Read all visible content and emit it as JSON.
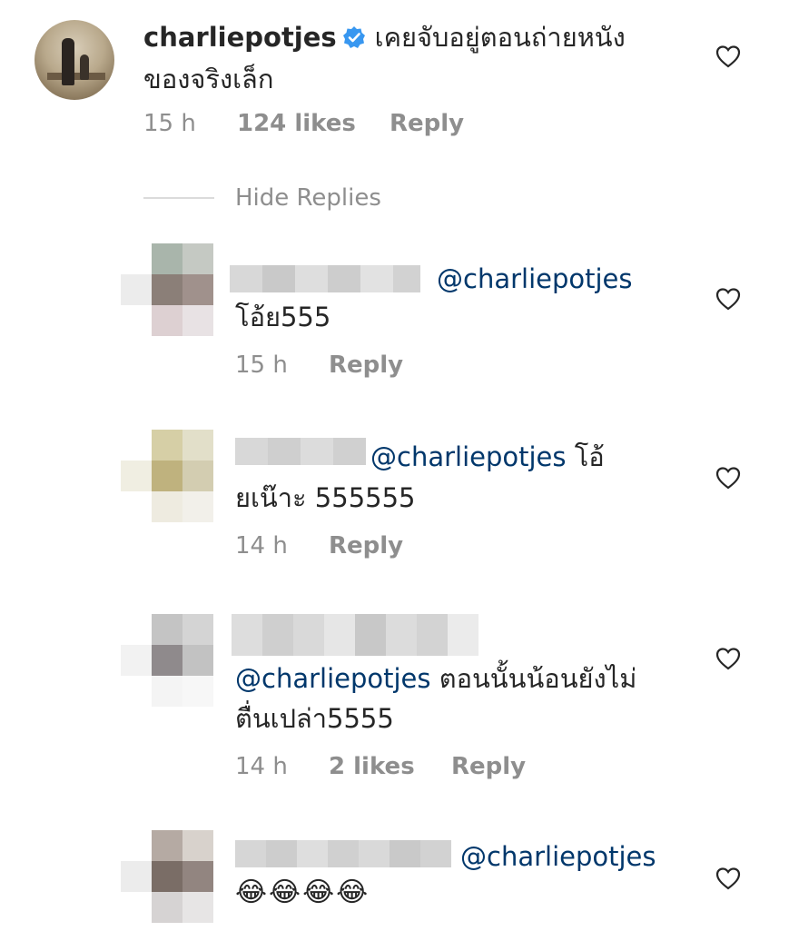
{
  "main_comment": {
    "author": "charlie­potjes",
    "text_line1": "เคยจับอยู่ตอนถ่ายหนัง",
    "text_line2": "ของจริงเล็ก",
    "time": "15 h",
    "likes": "124 likes",
    "reply": "Reply"
  },
  "hide_replies": "Hide Replies",
  "replies": [
    {
      "mention": "@charliepotjes",
      "text_line1": "โอ้ย555",
      "time": "15 h",
      "reply": "Reply"
    },
    {
      "mention": "@charliepotjes",
      "text_line1_after": " โอ้",
      "text_line2": "ยเน๊าะ 555555",
      "time": "14 h",
      "reply": "Reply"
    },
    {
      "mention": "@charliepotjes",
      "text_line1_after": " ตอนนั้นน้อนยังไม่",
      "text_line2": "ตื่นเปล่า5555",
      "time": "14 h",
      "likes": "2 likes",
      "reply": "Reply"
    },
    {
      "mention": "@charliepotjes",
      "emoji": "😂😂😂😂"
    }
  ],
  "colors": {
    "text": "#262626",
    "meta": "#8e8e8e",
    "mention": "#00376b",
    "verified": "#3897f0"
  }
}
